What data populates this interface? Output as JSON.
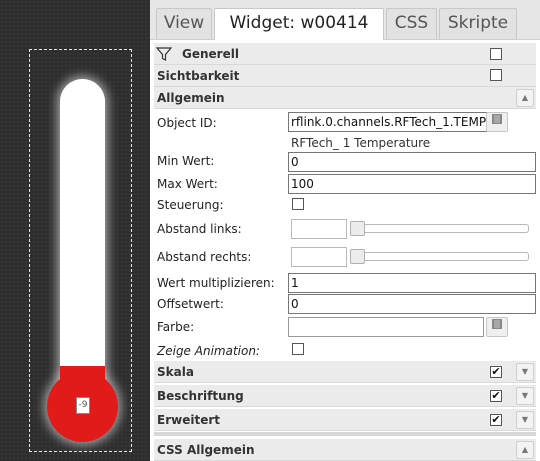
{
  "canvas": {
    "thermometer": {
      "value_label": "-9",
      "fill_color": "#e11a1a"
    }
  },
  "tabs": [
    {
      "label": "View",
      "active": false
    },
    {
      "label": "Widget:  w00414",
      "active": true
    },
    {
      "label": "CSS",
      "active": false
    },
    {
      "label": "Skripte",
      "active": false
    }
  ],
  "groups": {
    "generell": {
      "title": "Generell",
      "checked": false
    },
    "sichtbarkeit": {
      "title": "Sichtbarkeit",
      "checked": false
    },
    "allgemein": {
      "title": "Allgemein"
    },
    "skala": {
      "title": "Skala",
      "checked": true
    },
    "beschriftung": {
      "title": "Beschriftung",
      "checked": true
    },
    "erweitert": {
      "title": "Erweitert",
      "checked": true
    },
    "css_allgemein": {
      "title": "CSS Allgemein"
    }
  },
  "fields": {
    "object_id": {
      "label": "Object ID:",
      "value": "rflink.0.channels.RFTech_1.TEMP",
      "description": "RFTech_ 1 Temperature"
    },
    "min_wert": {
      "label": "Min Wert:",
      "value": "0"
    },
    "max_wert": {
      "label": "Max Wert:",
      "value": "100"
    },
    "steuerung": {
      "label": "Steuerung:",
      "checked": false
    },
    "abstand_links": {
      "label": "Abstand links:",
      "value": ""
    },
    "abstand_rechts": {
      "label": "Abstand rechts:",
      "value": ""
    },
    "wert_multiplizieren": {
      "label": "Wert multiplizieren:",
      "value": "1"
    },
    "offsetwert": {
      "label": "Offsetwert:",
      "value": "0"
    },
    "farbe": {
      "label": "Farbe:",
      "value": ""
    },
    "zeige_animation": {
      "label": "Zeige Animation:",
      "checked": false
    }
  },
  "icons": {
    "filter": "filter-icon",
    "chevron_up": "▲",
    "chevron_down": "▼",
    "select_button": "select-id-icon",
    "color_button": "color-picker-icon",
    "checkmark": "✔"
  }
}
